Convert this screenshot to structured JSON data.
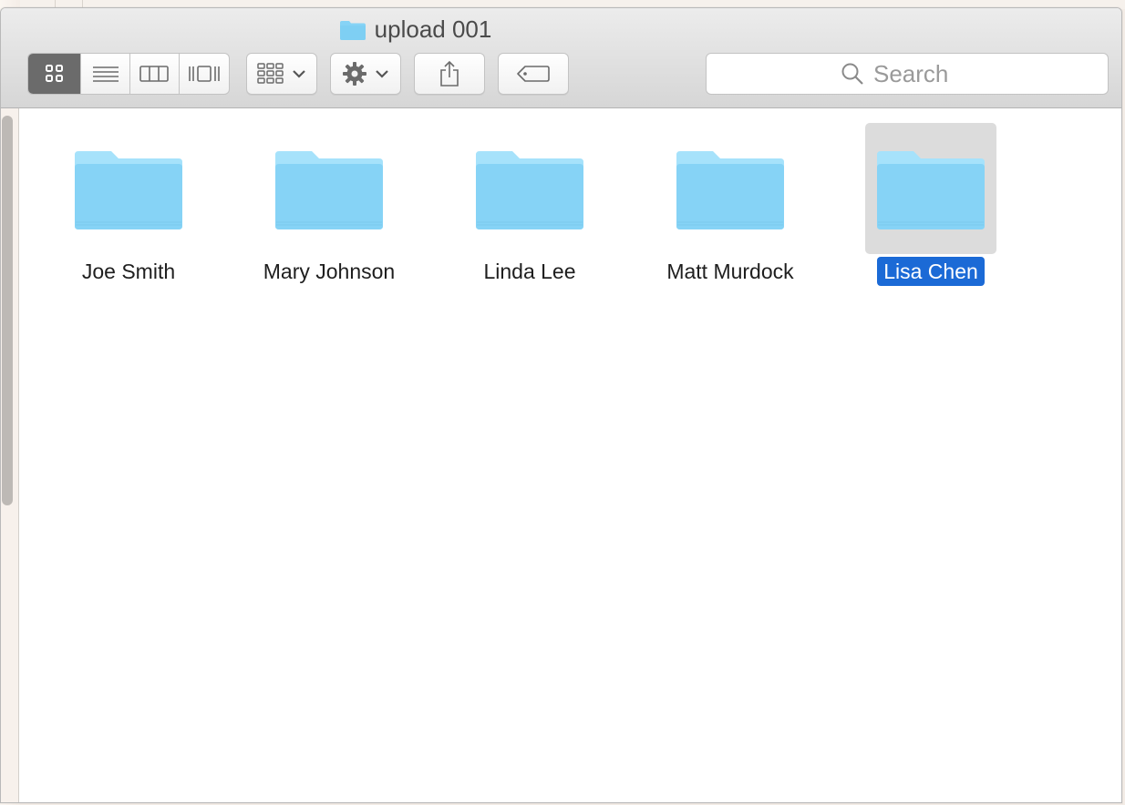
{
  "window": {
    "title": "upload 001"
  },
  "toolbar": {
    "view_modes": [
      {
        "name": "icon-view",
        "active": true
      },
      {
        "name": "list-view",
        "active": false
      },
      {
        "name": "column-view",
        "active": false
      },
      {
        "name": "cover-flow-view",
        "active": false
      }
    ],
    "arrange_icon": "arrange-grid-icon",
    "action_icon": "gear-icon",
    "share_icon": "share-icon",
    "tag_icon": "tag-icon"
  },
  "search": {
    "placeholder": "Search"
  },
  "folders": [
    {
      "name": "Joe Smith",
      "selected": false
    },
    {
      "name": "Mary Johnson",
      "selected": false
    },
    {
      "name": "Linda Lee",
      "selected": false
    },
    {
      "name": "Matt Murdock",
      "selected": false
    },
    {
      "name": "Lisa Chen",
      "selected": true
    }
  ],
  "colors": {
    "folder_light": "#a6e2fb",
    "folder_main": "#86d3f6",
    "selection": "#1b6ad6",
    "selection_bg": "#dcdcdc"
  }
}
